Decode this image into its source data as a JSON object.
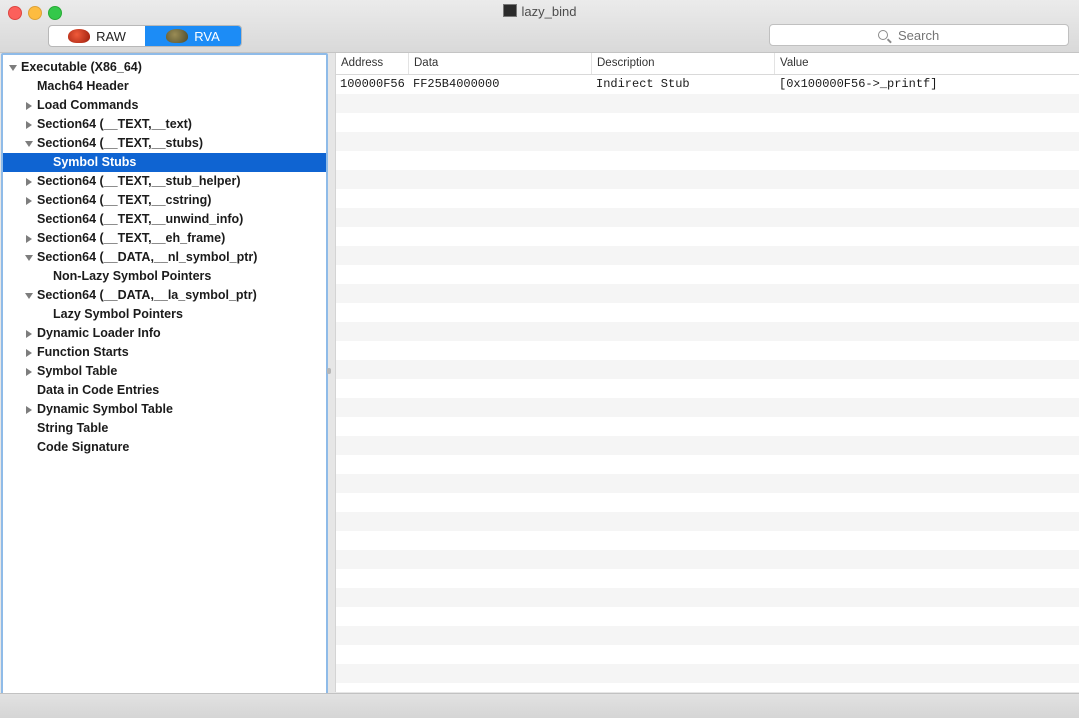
{
  "window": {
    "title": "lazy_bind"
  },
  "toolbar": {
    "segments": [
      {
        "label": "RAW",
        "icon": "red-beetle-icon",
        "active": false
      },
      {
        "label": "RVA",
        "icon": "green-beetle-icon",
        "active": true
      }
    ],
    "search": {
      "placeholder": "Search",
      "value": ""
    }
  },
  "sidebar": {
    "items": [
      {
        "label": "Executable  (X86_64)",
        "level": 0,
        "disclosure": "expanded",
        "selected": false
      },
      {
        "label": "Mach64 Header",
        "level": 1,
        "disclosure": "none",
        "selected": false
      },
      {
        "label": "Load Commands",
        "level": 1,
        "disclosure": "collapsed",
        "selected": false
      },
      {
        "label": "Section64 (__TEXT,__text)",
        "level": 1,
        "disclosure": "collapsed",
        "selected": false
      },
      {
        "label": "Section64 (__TEXT,__stubs)",
        "level": 1,
        "disclosure": "expanded",
        "selected": false
      },
      {
        "label": "Symbol Stubs",
        "level": 2,
        "disclosure": "none",
        "selected": true
      },
      {
        "label": "Section64 (__TEXT,__stub_helper)",
        "level": 1,
        "disclosure": "collapsed",
        "selected": false
      },
      {
        "label": "Section64 (__TEXT,__cstring)",
        "level": 1,
        "disclosure": "collapsed",
        "selected": false
      },
      {
        "label": "Section64 (__TEXT,__unwind_info)",
        "level": 1,
        "disclosure": "none",
        "selected": false
      },
      {
        "label": "Section64 (__TEXT,__eh_frame)",
        "level": 1,
        "disclosure": "collapsed",
        "selected": false
      },
      {
        "label": "Section64 (__DATA,__nl_symbol_ptr)",
        "level": 1,
        "disclosure": "expanded",
        "selected": false
      },
      {
        "label": "Non-Lazy Symbol Pointers",
        "level": 2,
        "disclosure": "none",
        "selected": false
      },
      {
        "label": "Section64 (__DATA,__la_symbol_ptr)",
        "level": 1,
        "disclosure": "expanded",
        "selected": false
      },
      {
        "label": "Lazy Symbol Pointers",
        "level": 2,
        "disclosure": "none",
        "selected": false
      },
      {
        "label": "Dynamic Loader Info",
        "level": 1,
        "disclosure": "collapsed",
        "selected": false
      },
      {
        "label": "Function Starts",
        "level": 1,
        "disclosure": "collapsed",
        "selected": false
      },
      {
        "label": "Symbol Table",
        "level": 1,
        "disclosure": "collapsed",
        "selected": false
      },
      {
        "label": "Data in Code Entries",
        "level": 1,
        "disclosure": "none",
        "selected": false
      },
      {
        "label": "Dynamic Symbol Table",
        "level": 1,
        "disclosure": "collapsed",
        "selected": false
      },
      {
        "label": "String Table",
        "level": 1,
        "disclosure": "none",
        "selected": false
      },
      {
        "label": "Code Signature",
        "level": 1,
        "disclosure": "none",
        "selected": false
      }
    ]
  },
  "table": {
    "columns": [
      "Address",
      "Data",
      "Description",
      "Value"
    ],
    "rows": [
      [
        "100000F56",
        "FF25B4000000",
        "Indirect Stub",
        "[0x100000F56->_printf]"
      ]
    ]
  },
  "colors": {
    "accent": "#1c8cf6",
    "selection": "#0f64d2",
    "sidebar_border": "#8fbbe8"
  }
}
